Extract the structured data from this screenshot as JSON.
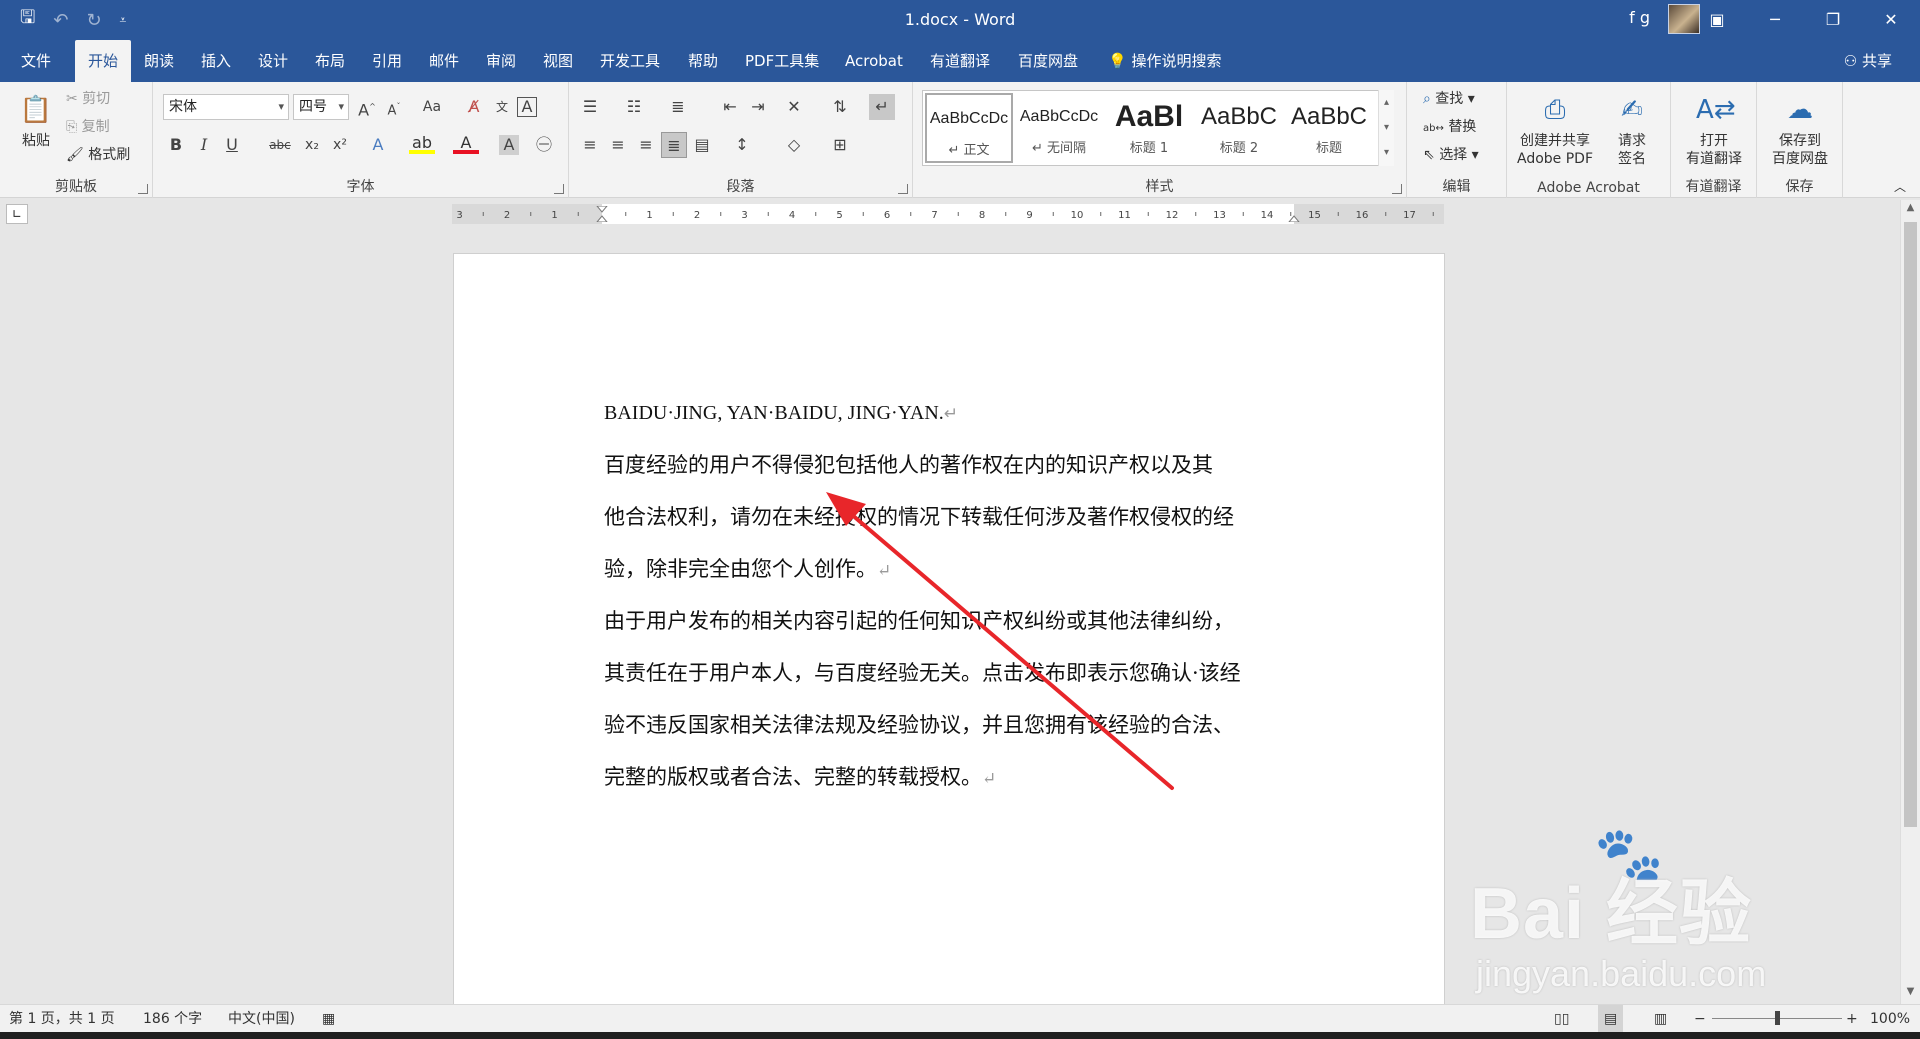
{
  "window": {
    "title": "1.docx  -  Word",
    "user": "f g",
    "qat_icons": [
      "save-icon",
      "undo-icon",
      "redo-icon",
      "customize-icon"
    ],
    "controls": [
      "ribbon-display-options-icon",
      "minimize-icon",
      "restore-icon",
      "close-icon"
    ]
  },
  "tabs": [
    "文件",
    "开始",
    "朗读",
    "插入",
    "设计",
    "布局",
    "引用",
    "邮件",
    "审阅",
    "视图",
    "开发工具",
    "帮助",
    "PDF工具集",
    "Acrobat",
    "有道翻译",
    "百度网盘"
  ],
  "active_tab": "开始",
  "tell_me": "操作说明搜索",
  "share": "共享",
  "ribbon": {
    "clipboard": {
      "label": "剪贴板",
      "paste": "粘贴",
      "cut": "剪切",
      "copy": "复制",
      "format_painter": "格式刷"
    },
    "font": {
      "label": "字体",
      "font_name": "宋体",
      "font_size": "四号",
      "change_case": "Aa",
      "bold": "B",
      "italic": "I",
      "underline": "U",
      "strike": "abc",
      "subscript": "x₂",
      "superscript": "x²"
    },
    "paragraph": {
      "label": "段落"
    },
    "styles": {
      "label": "样式",
      "items": [
        {
          "sample": "AaBbCcDc",
          "name": "↵ 正文"
        },
        {
          "sample": "AaBbCcDc",
          "name": "↵ 无间隔"
        },
        {
          "sample": "AaBl",
          "name": "标题 1"
        },
        {
          "sample": "AaBbC",
          "name": "标题 2"
        },
        {
          "sample": "AaBbC",
          "name": "标题"
        }
      ]
    },
    "editing": {
      "label": "编辑",
      "find": "查找",
      "replace": "替换",
      "select": "选择"
    },
    "acrobat": {
      "label": "Adobe Acrobat",
      "create_share": "创建并共享",
      "create_share2": "Adobe PDF",
      "request_sign": "请求",
      "request_sign2": "签名"
    },
    "youdao": {
      "label": "有道翻译",
      "open": "打开",
      "open2": "有道翻译"
    },
    "save": {
      "label": "保存",
      "save_to": "保存到",
      "save_to2": "百度网盘"
    }
  },
  "ruler_numbers": [
    "3",
    "2",
    "1",
    "",
    "1",
    "2",
    "3",
    "4",
    "5",
    "6",
    "7",
    "8",
    "9",
    "10",
    "11",
    "12",
    "13",
    "14",
    "15",
    "16",
    "17"
  ],
  "document": {
    "lines": [
      "BAIDU·JING, YAN·BAIDU, JING·YAN.",
      "百度经验的用户不得侵犯包括他人的著作权在内的知识产权以及其",
      "他合法权利，请勿在未经授权的情况下转载任何涉及著作权侵权的经",
      "验，除非完全由您个人创作。",
      "由于用户发布的相关内容引起的任何知识产权纠纷或其他法律纠纷，",
      "其责任在于用户本人，与百度经验无关。点击发布即表示您确认·该经",
      "验不违反国家相关法律法规及经验协议，并且您拥有该经验的合法、",
      "完整的版权或者合法、完整的转载授权。"
    ],
    "paragraph_mark": "↵"
  },
  "watermark": {
    "brand": "Bai 经验",
    "url": "jingyan.baidu.com"
  },
  "status": {
    "page": "第 1 页，共 1 页",
    "words": "186 个字",
    "language": "中文(中国)",
    "zoom_minus": "−",
    "zoom_plus": "+",
    "zoom": "100%",
    "zoom_fraction": 0.5
  },
  "colors": {
    "accent": "#2b579a",
    "arrow": "#e8262a"
  }
}
